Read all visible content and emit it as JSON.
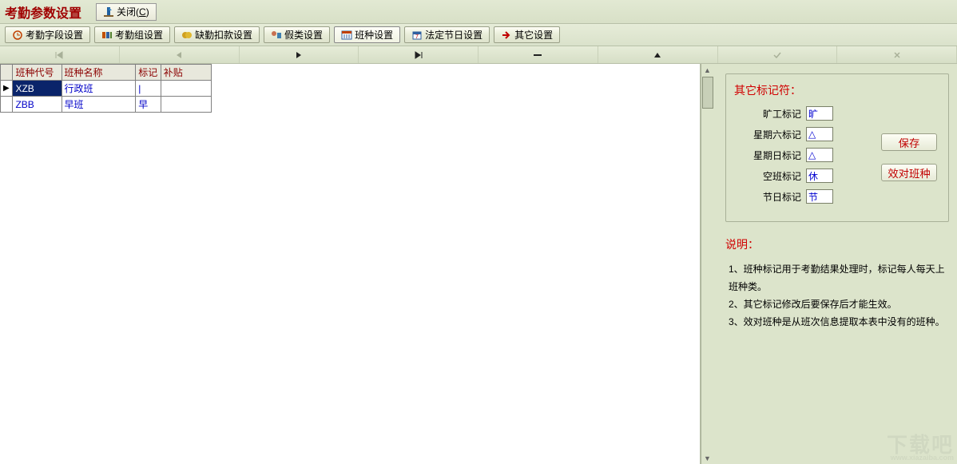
{
  "title": "考勤参数设置",
  "close_label": "关闭(",
  "close_key": "C",
  "close_label2": ")",
  "tabs": [
    {
      "label": "考勤字段设置"
    },
    {
      "label": "考勤组设置"
    },
    {
      "label": "缺勤扣款设置"
    },
    {
      "label": "假类设置"
    },
    {
      "label": "班种设置"
    },
    {
      "label": "法定节日设置"
    },
    {
      "label": "其它设置"
    }
  ],
  "grid": {
    "headers": [
      "班种代号",
      "班种名称",
      "标记",
      "补贴"
    ],
    "rows": [
      {
        "code": "XZB",
        "name": "行政班",
        "mark": "|",
        "allow": "",
        "selected": true
      },
      {
        "code": "ZBB",
        "name": "早班",
        "mark": "早",
        "allow": "",
        "selected": false
      }
    ]
  },
  "side": {
    "legend": "其它标记符：",
    "items": [
      {
        "label": "旷工标记",
        "value": "旷"
      },
      {
        "label": "星期六标记",
        "value": "△"
      },
      {
        "label": "星期日标记",
        "value": "△"
      },
      {
        "label": "空班标记",
        "value": "休"
      },
      {
        "label": "节日标记",
        "value": "节"
      }
    ],
    "btn_save": "保存",
    "btn_checkshift": "效对班种"
  },
  "notes_title": "说明：",
  "notes": [
    "1、班种标记用于考勤结果处理时，标记每人每天上班种类。",
    "2、其它标记修改后要保存后才能生效。",
    "3、效对班种是从班次信息提取本表中没有的班种。"
  ],
  "watermark": "下载吧",
  "watermark_url": "www.xiazaiba.com"
}
